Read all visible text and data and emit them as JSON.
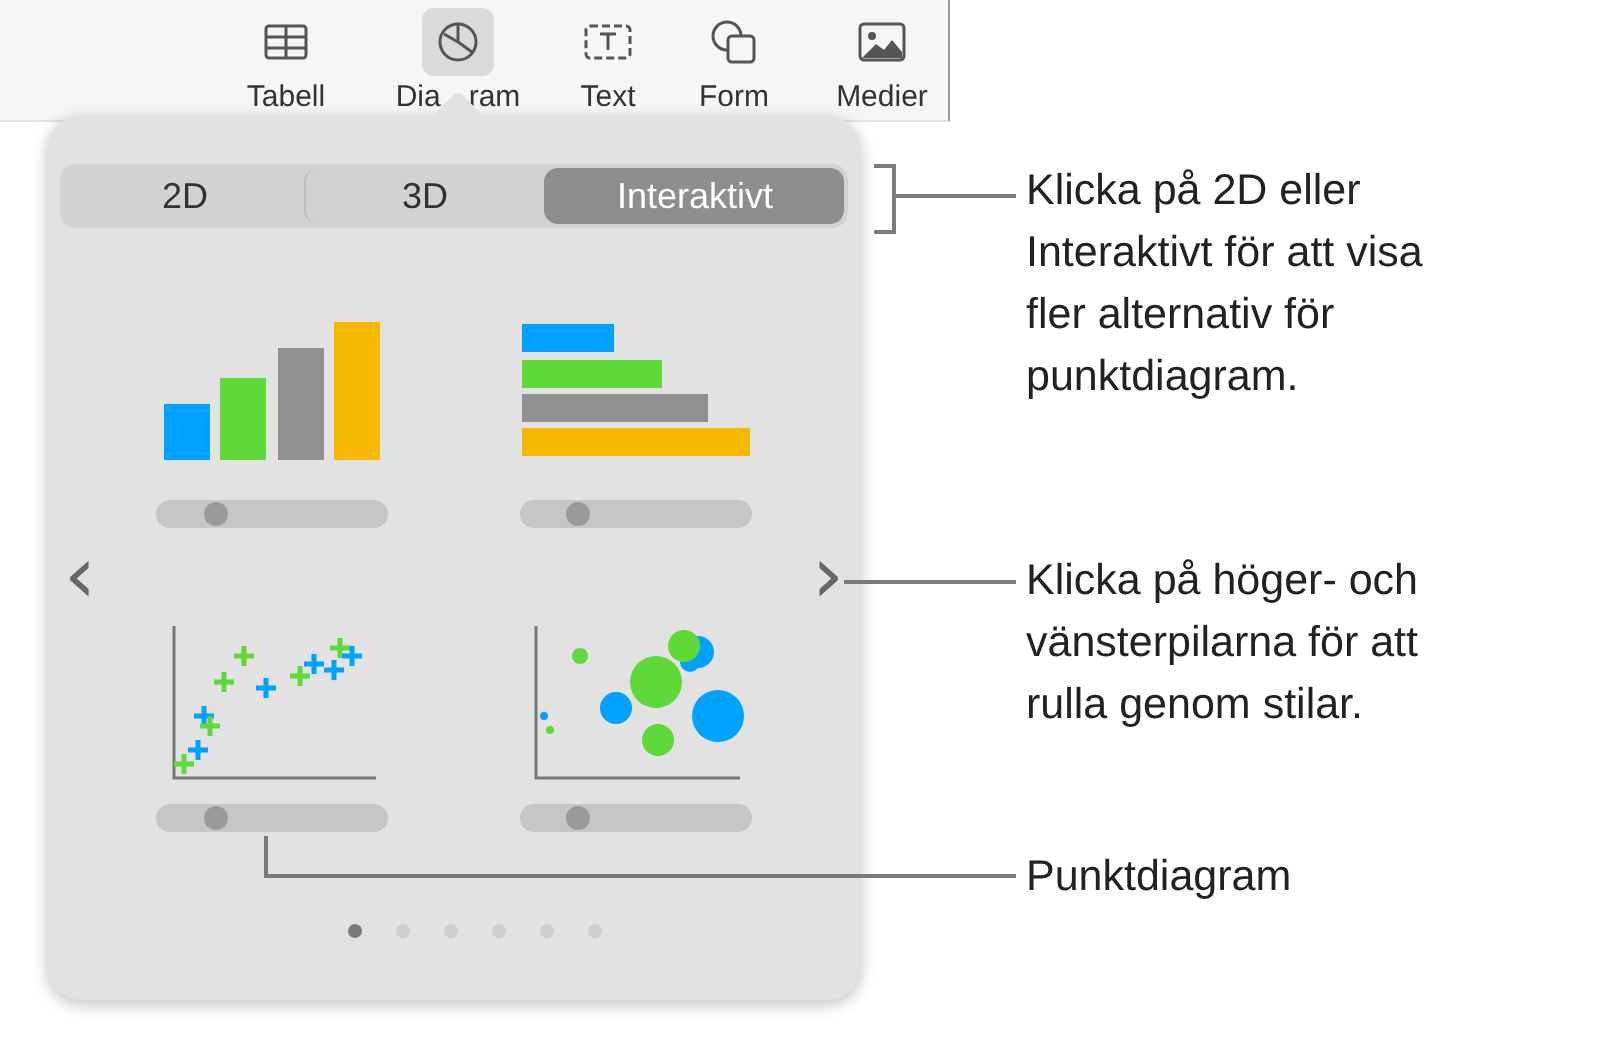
{
  "toolbar": [
    {
      "label": "Tabell",
      "selected": false
    },
    {
      "label": "Dia",
      "label_after": "ram",
      "selected": true
    },
    {
      "label": "Text",
      "selected": false
    },
    {
      "label": "Form",
      "selected": false
    },
    {
      "label": "Medier",
      "selected": false
    }
  ],
  "popover": {
    "segments": [
      {
        "label": "2D",
        "selected": false
      },
      {
        "label": "3D",
        "selected": false
      },
      {
        "label": "Interaktivt",
        "selected": true
      }
    ],
    "charts": [
      {
        "kind": "bar",
        "level": 0.26
      },
      {
        "kind": "hbar",
        "level": 0.25
      },
      {
        "kind": "scatter",
        "level": 0.26
      },
      {
        "kind": "bubble",
        "level": 0.25
      }
    ],
    "prev_arrow": "‹",
    "next_arrow": "›",
    "pages": [
      {
        "selected": true
      },
      {
        "selected": false
      },
      {
        "selected": false
      },
      {
        "selected": false
      },
      {
        "selected": false
      },
      {
        "selected": false
      }
    ]
  },
  "callouts": [
    {
      "text": "Klicka på 2D eller Interaktivt för att visa fler alternativ för punktdiagram."
    },
    {
      "text": "Klicka på höger- och vänsterpilarna för att rulla genom stilar."
    },
    {
      "text": "Punktdiagram"
    }
  ]
}
